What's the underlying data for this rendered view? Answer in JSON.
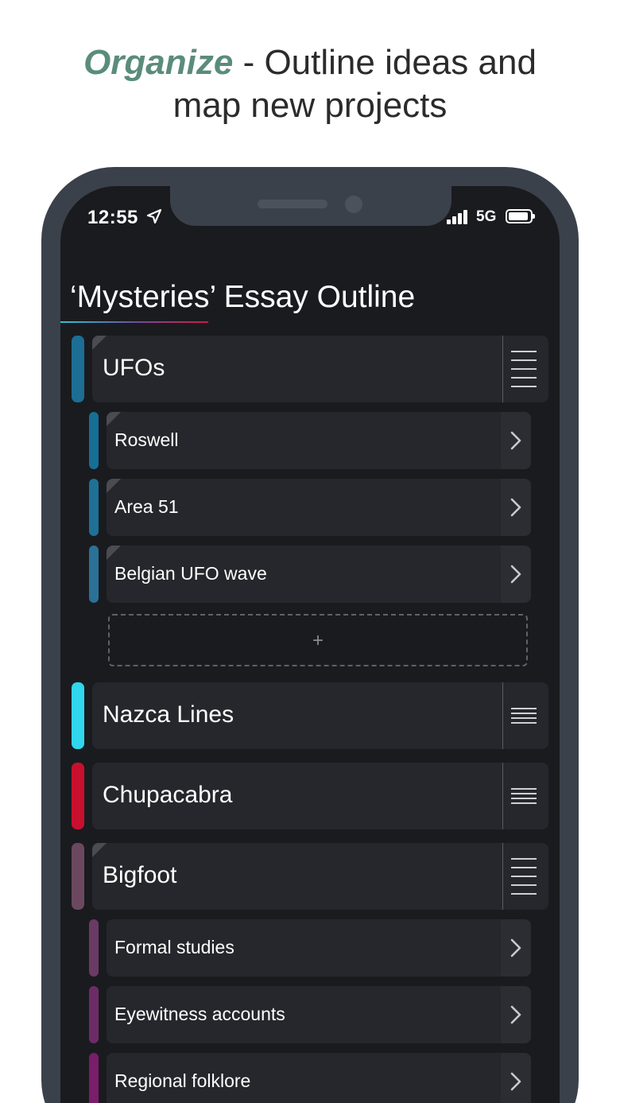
{
  "headline": {
    "accent": "Organize",
    "rest_line1": " - Outline ideas and",
    "line2": "map new projects"
  },
  "status_bar": {
    "time": "12:55",
    "network": "5G"
  },
  "title": "‘Mysteries’ Essay Outline",
  "sections": [
    {
      "label": "UFOs",
      "color": "#1c6e94",
      "expanded": true,
      "children": [
        {
          "label": "Roswell",
          "color": "#176f96"
        },
        {
          "label": "Area 51",
          "color": "#1f7097"
        },
        {
          "label": "Belgian UFO wave",
          "color": "#2b7197"
        }
      ]
    },
    {
      "label": "Nazca Lines",
      "color": "#2fd6ec",
      "expanded": false
    },
    {
      "label": "Chupacabra",
      "color": "#c8102e",
      "expanded": false
    },
    {
      "label": "Bigfoot",
      "color": "#6c4860",
      "expanded": true,
      "children": [
        {
          "label": "Formal studies",
          "color": "#6a3a65"
        },
        {
          "label": "Eyewitness accounts",
          "color": "#6d2c67"
        },
        {
          "label": "Regional folklore",
          "color": "#7a1d6a"
        }
      ]
    }
  ],
  "add_button": "+"
}
